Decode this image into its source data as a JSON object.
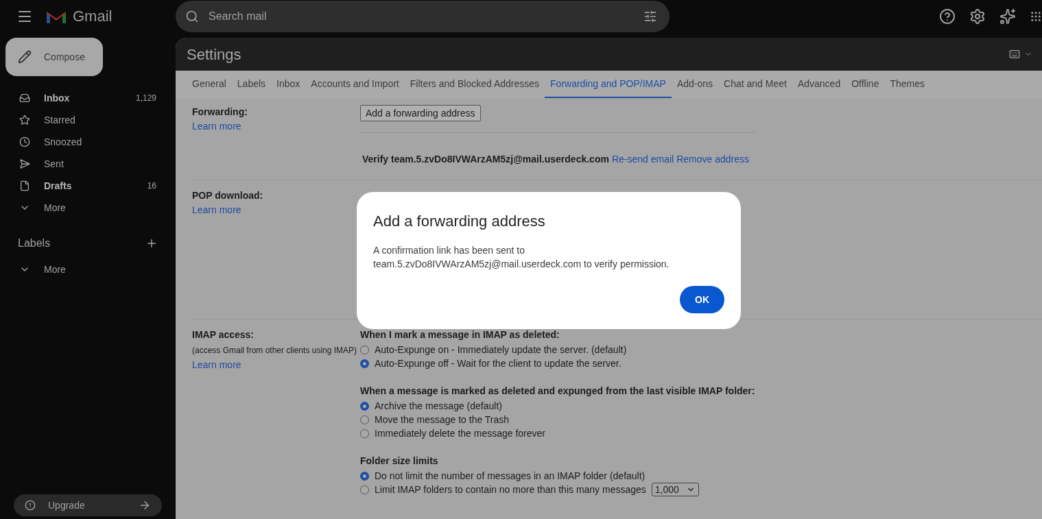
{
  "header": {
    "app_name": "Gmail",
    "search_placeholder": "Search mail"
  },
  "sidebar": {
    "compose": "Compose",
    "items": [
      {
        "label": "Inbox",
        "count": "1,129",
        "unread": true
      },
      {
        "label": "Starred",
        "unread": false
      },
      {
        "label": "Snoozed",
        "unread": false
      },
      {
        "label": "Sent",
        "unread": false
      },
      {
        "label": "Drafts",
        "count": "16",
        "unread": true
      },
      {
        "label": "More",
        "unread": false
      }
    ],
    "labels_heading": "Labels",
    "labels_more": "More",
    "upgrade": "Upgrade"
  },
  "settings": {
    "title": "Settings",
    "tabs": [
      {
        "label": "General",
        "selected": false
      },
      {
        "label": "Labels",
        "selected": false
      },
      {
        "label": "Inbox",
        "selected": false
      },
      {
        "label": "Accounts and Import",
        "selected": false
      },
      {
        "label": "Filters and Blocked Addresses",
        "selected": false
      },
      {
        "label": "Forwarding and POP/IMAP",
        "selected": true
      },
      {
        "label": "Add-ons",
        "selected": false
      },
      {
        "label": "Chat and Meet",
        "selected": false
      },
      {
        "label": "Advanced",
        "selected": false
      },
      {
        "label": "Offline",
        "selected": false
      },
      {
        "label": "Themes",
        "selected": false
      }
    ],
    "forwarding": {
      "label": "Forwarding:",
      "learn_more": "Learn more",
      "button": "Add a forwarding address",
      "verify": "Verify team.5.zvDo8IVWArzAM5zj@mail.userdeck.com",
      "links": [
        "Re-send email",
        "Remove address"
      ]
    },
    "pop": {
      "label": "POP download:",
      "learn_more": "Learn more"
    },
    "imap": {
      "label": "IMAP access:",
      "note": "(access Gmail from other clients using IMAP)",
      "learn_more": "Learn more",
      "groups": [
        {
          "heading": "When I mark a message in IMAP as deleted:",
          "options": [
            {
              "label": "Auto-Expunge on - Immediately update the server. (default)",
              "selected": false
            },
            {
              "label": "Auto-Expunge off - Wait for the client to update the server.",
              "selected": true
            }
          ]
        },
        {
          "heading": "When a message is marked as deleted and expunged from the last visible IMAP folder:",
          "options": [
            {
              "label": "Archive the message (default)",
              "selected": true
            },
            {
              "label": "Move the message to the Trash",
              "selected": false
            },
            {
              "label": "Immediately delete the message forever",
              "selected": false
            }
          ]
        },
        {
          "heading": "Folder size limits",
          "options": [
            {
              "label": "Do not limit the number of messages in an IMAP folder (default)",
              "selected": true
            },
            {
              "label": "Limit IMAP folders to contain no more than this many messages",
              "selected": false,
              "select_value": "1,000"
            }
          ]
        }
      ]
    }
  },
  "dialog": {
    "title": "Add a forwarding address",
    "body": "A confirmation link has been sent to team.5.zvDo8IVWArzAM5zj@mail.userdeck.com to verify permission.",
    "ok": "OK"
  }
}
